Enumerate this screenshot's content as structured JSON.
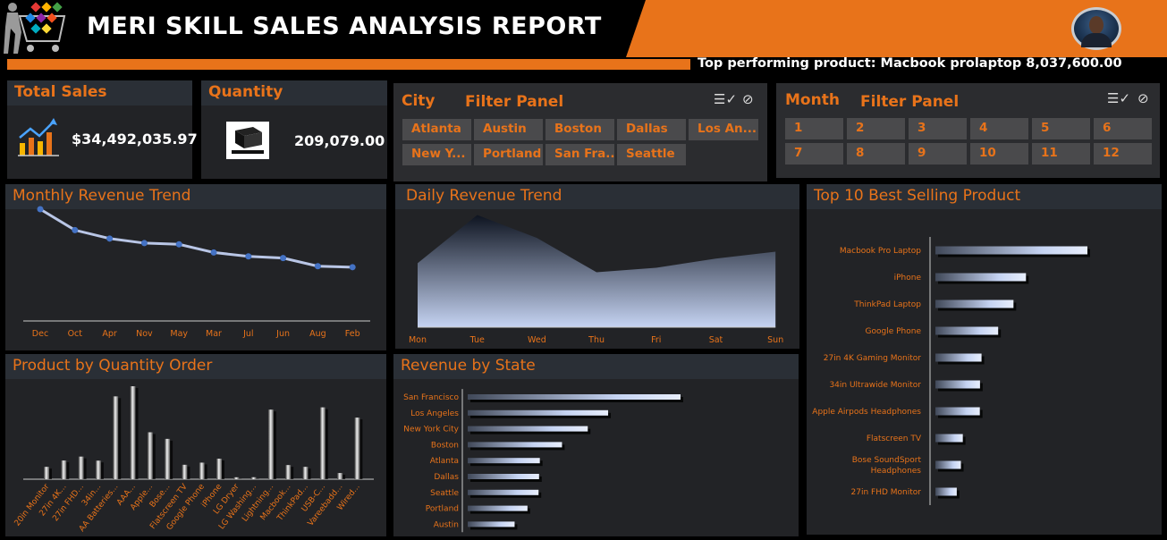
{
  "header": {
    "title": "MERI SKILL SALES ANALYSIS REPORT",
    "top_product": "Top performing product: Macbook prolaptop 8,037,600.00"
  },
  "colors": {
    "accent": "#e8731a",
    "panel": "#222326",
    "bar": "#9fb3d9"
  },
  "kpis": {
    "sales": {
      "label": "Total Sales",
      "value": "$34,492,035.97",
      "icon": "chart-growth-icon"
    },
    "quantity": {
      "label": "Quantity",
      "value": "209,079.00",
      "icon": "pallet-boxes-icon"
    }
  },
  "city_filter": {
    "title": "City",
    "subtitle": "Filter Panel",
    "options": [
      "Atlanta",
      "Austin",
      "Boston",
      "Dallas",
      "Los An...",
      "New Y...",
      "Portland",
      "San Fra...",
      "Seattle"
    ]
  },
  "month_filter": {
    "title": "Month",
    "subtitle": "Filter Panel",
    "options": [
      "1",
      "2",
      "3",
      "4",
      "5",
      "6",
      "7",
      "8",
      "9",
      "10",
      "11",
      "12"
    ]
  },
  "chart_data": [
    {
      "type": "line",
      "title": "Monthly Revenue Trend",
      "categories": [
        "Dec",
        "Oct",
        "Apr",
        "Nov",
        "May",
        "Mar",
        "Jul",
        "Jun",
        "Aug",
        "Feb"
      ],
      "values": [
        4.61,
        3.74,
        3.39,
        3.2,
        3.15,
        2.81,
        2.65,
        2.58,
        2.24,
        2.2
      ]
    },
    {
      "type": "area",
      "title": "Daily Revenue Trend",
      "categories": [
        "Mon",
        "Tue",
        "Wed",
        "Thu",
        "Fri",
        "Sat",
        "Sun"
      ],
      "values": [
        4.88,
        5.09,
        4.99,
        4.84,
        4.86,
        4.9,
        4.93
      ],
      "ylim": [
        4.6,
        5.1
      ]
    },
    {
      "type": "bar",
      "title": "Top 10 Best Selling Product",
      "categories": [
        "Macbook Pro Laptop",
        "iPhone",
        "ThinkPad Laptop",
        "Google Phone",
        "27in 4K Gaming Monitor",
        "34in Ultrawide Monitor",
        "Apple Airpods Headphones",
        "Flatscreen TV",
        "Bose SoundSport Headphones",
        "27in FHD Monitor"
      ],
      "values": [
        8.04,
        4.79,
        4.13,
        3.32,
        2.44,
        2.36,
        2.35,
        1.45,
        1.35,
        1.13
      ]
    },
    {
      "type": "bar",
      "title": "Product by Quantity Order",
      "categories": [
        "20in Monitor",
        "27in 4K...",
        "27in FHD...",
        "34in...",
        "AA Batteries...",
        "AAA...",
        "Apple...",
        "Bose...",
        "Flatscreen TV",
        "Google Phone",
        "iPhone",
        "LG Dryer",
        "LG Washing...",
        "Lightning...",
        "Macbook...",
        "ThinkPad...",
        "USB-C...",
        "Vareebadd...",
        "Wired..."
      ],
      "values": [
        4129,
        6244,
        7550,
        6199,
        27635,
        31017,
        15661,
        13457,
        4819,
        5532,
        6849,
        646,
        666,
        23217,
        4728,
        4130,
        23975,
        2068,
        20557
      ]
    },
    {
      "type": "bar",
      "title": "Revenue  by State",
      "categories": [
        "San Francisco",
        "Los Angeles",
        "New York City",
        "Boston",
        "Atlanta",
        "Dallas",
        "Seattle",
        "Portland",
        "Austin"
      ],
      "values": [
        8.26,
        5.45,
        4.66,
        3.66,
        2.8,
        2.77,
        2.75,
        2.32,
        1.82
      ]
    }
  ]
}
